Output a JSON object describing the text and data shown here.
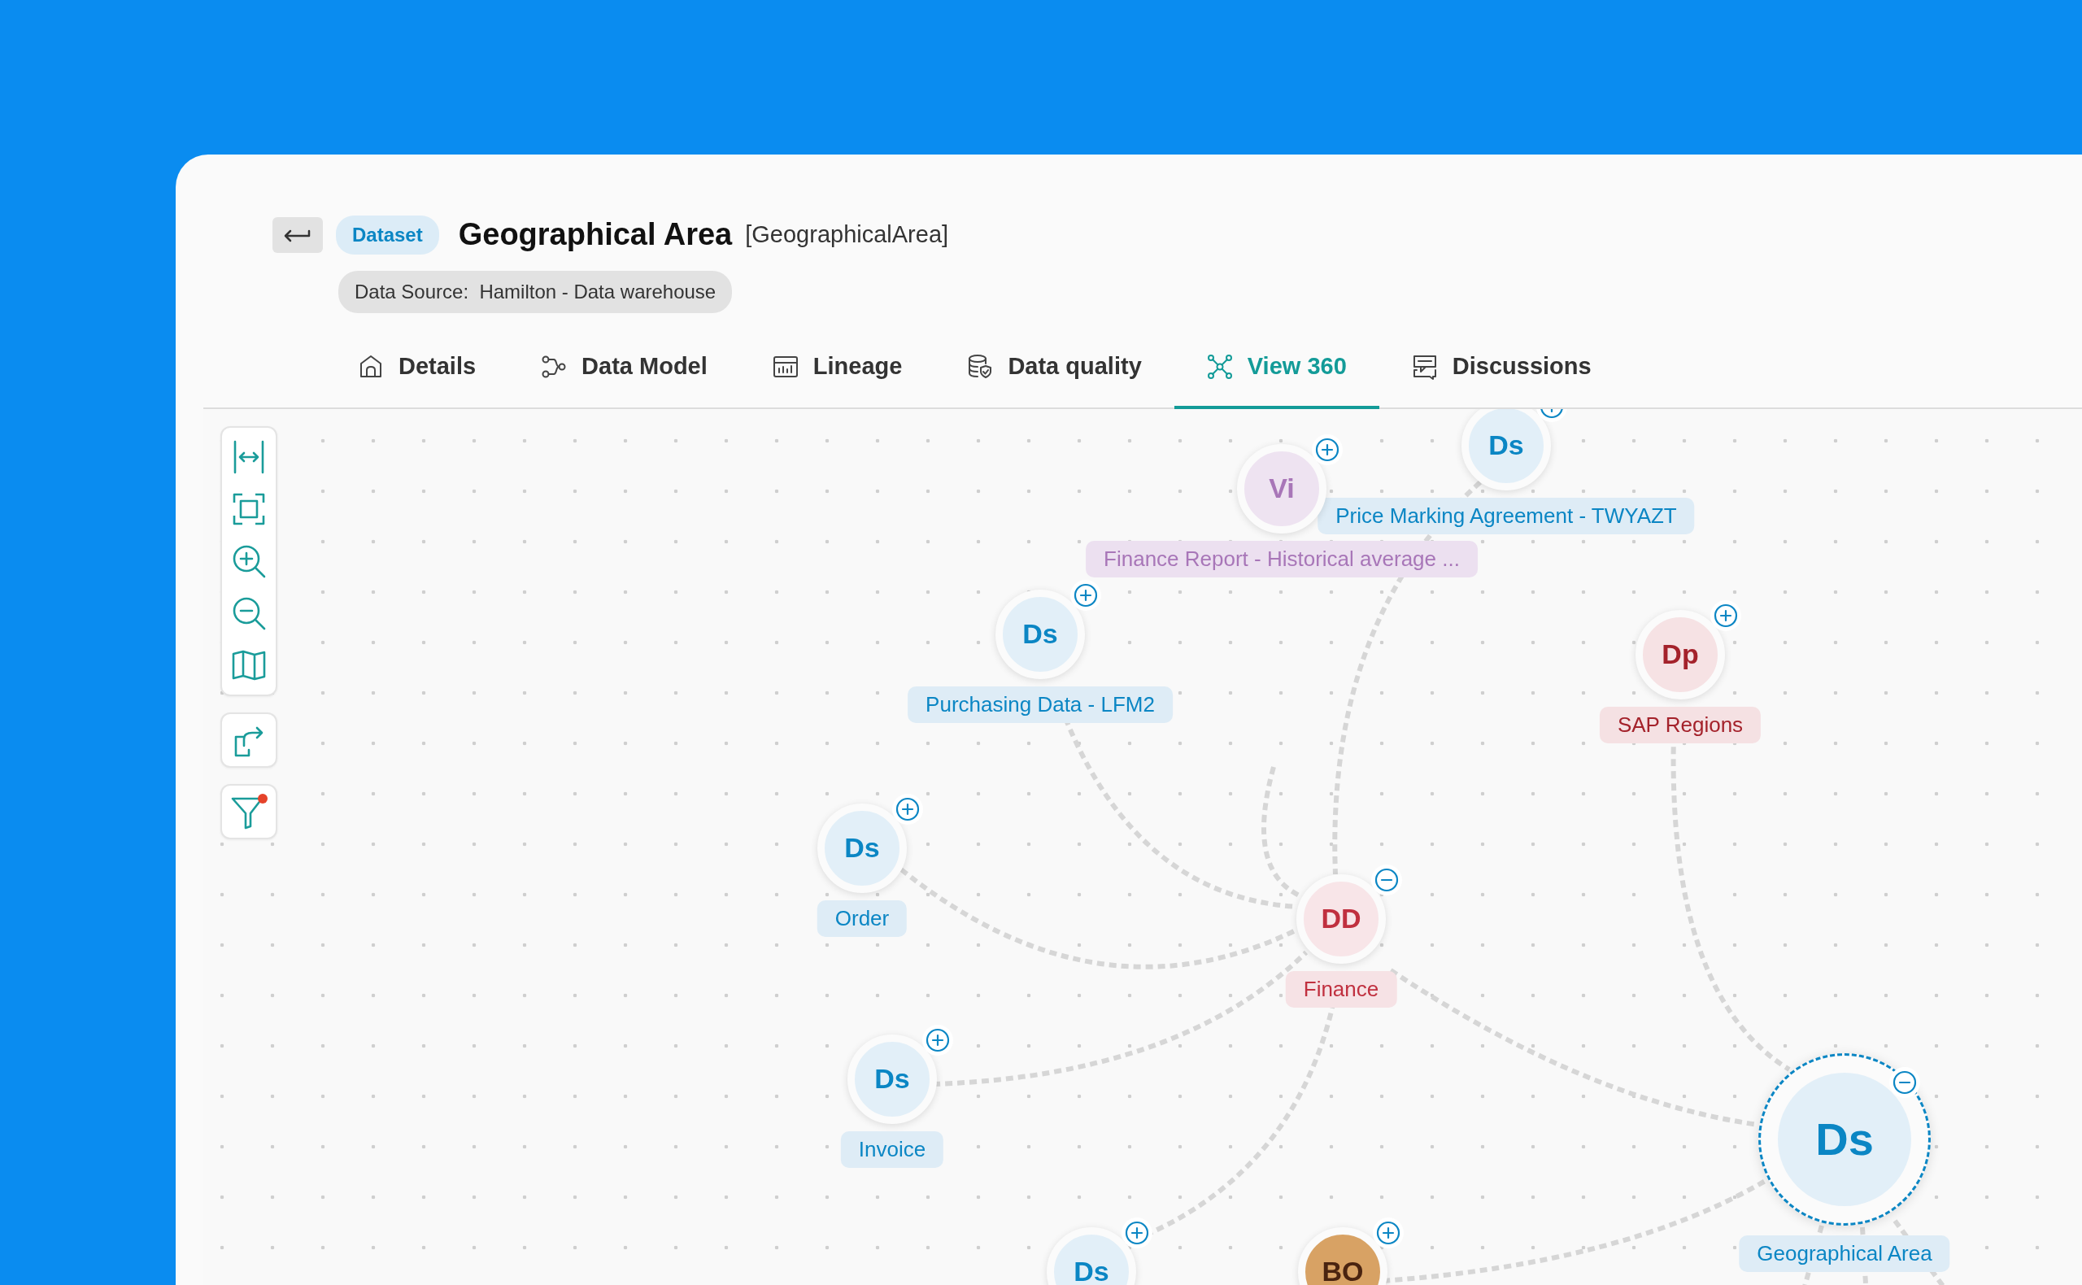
{
  "entity": {
    "type_badge": "Dataset",
    "title": "Geographical Area",
    "technical_name": "[GeographicalArea]",
    "data_source": "Data Source:  Hamilton - Data warehouse"
  },
  "tabs": [
    {
      "label": "Details",
      "selected": false
    },
    {
      "label": "Data Model",
      "selected": false
    },
    {
      "label": "Lineage",
      "selected": false
    },
    {
      "label": "Data quality",
      "selected": false
    },
    {
      "label": "View 360",
      "selected": true
    },
    {
      "label": "Discussions",
      "selected": false
    }
  ],
  "toolbar": {
    "filter_active": true
  },
  "graph": {
    "nodes": [
      {
        "kind": "dataset",
        "initials": "Ds",
        "label": "Price Marking Agreement - TWYAZT",
        "expanded": false,
        "selected": false
      },
      {
        "kind": "visual",
        "initials": "Vi",
        "label": "Finance Report - Historical average ...",
        "expanded": false,
        "selected": false
      },
      {
        "kind": "dataset",
        "initials": "Ds",
        "label": "Purchasing Data - LFM2",
        "expanded": false,
        "selected": false
      },
      {
        "kind": "product",
        "initials": "Dp",
        "label": "SAP Regions",
        "expanded": false,
        "selected": false
      },
      {
        "kind": "dataset",
        "initials": "Ds",
        "label": "Order",
        "expanded": false,
        "selected": false
      },
      {
        "kind": "domain",
        "initials": "DD",
        "label": "Finance",
        "expanded": true,
        "selected": false
      },
      {
        "kind": "dataset",
        "initials": "Ds",
        "label": "Invoice",
        "expanded": false,
        "selected": false
      },
      {
        "kind": "dataset",
        "initials": "Ds",
        "label": "Geographical Area",
        "expanded": true,
        "selected": true
      },
      {
        "kind": "dataset",
        "initials": "Ds",
        "expanded": false,
        "selected": false
      },
      {
        "kind": "business_object",
        "initials": "BO",
        "expanded": false,
        "selected": false
      }
    ]
  }
}
